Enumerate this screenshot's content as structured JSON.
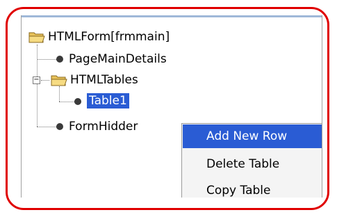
{
  "tree": {
    "root_label": "HTMLForm[frmmain]",
    "items": [
      {
        "label": "PageMainDetails"
      },
      {
        "label": "HTMLTables"
      },
      {
        "label": "Table1"
      },
      {
        "label": "FormHidder"
      }
    ]
  },
  "context_menu": {
    "items": [
      {
        "label": "Add New Row"
      },
      {
        "label": "Delete Table"
      },
      {
        "label": "Copy Table"
      }
    ]
  }
}
